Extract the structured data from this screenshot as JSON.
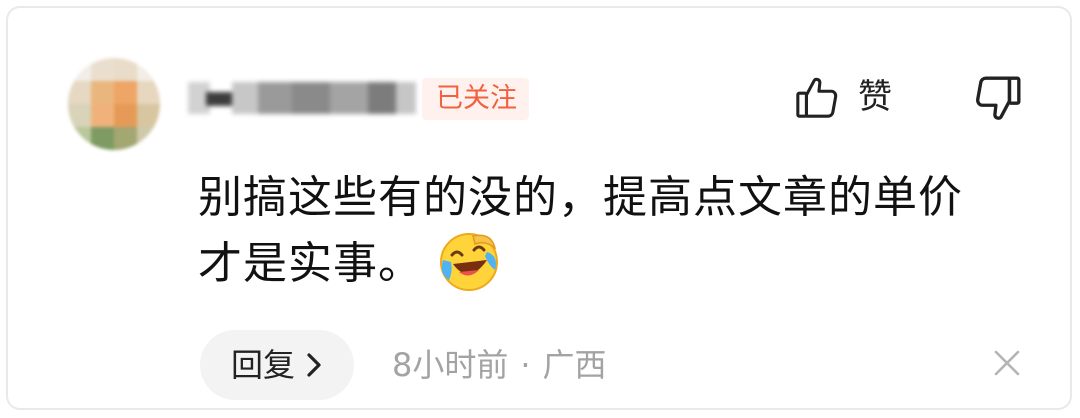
{
  "comment": {
    "author": {
      "follow_status": "已关注"
    },
    "actions": {
      "like_label": "赞"
    },
    "body": {
      "line1": "别搞这些有的没的，提高点文章的单价",
      "line2": "才是实事。",
      "emoji": "laughing-tears-emoji"
    },
    "footer": {
      "reply_label": "回复",
      "time": "8小时前",
      "separator": "·",
      "location": "广西"
    }
  },
  "icons": {
    "like": "thumbs-up-icon",
    "dislike": "thumbs-down-icon",
    "reply_arrow": "chevron-right-icon",
    "dismiss": "close-icon"
  },
  "colors": {
    "follow_tag_text": "#f2613f",
    "follow_tag_bg": "#fff2ee",
    "meta_text": "#a3a3a3",
    "reply_bg": "#f3f3f3"
  }
}
